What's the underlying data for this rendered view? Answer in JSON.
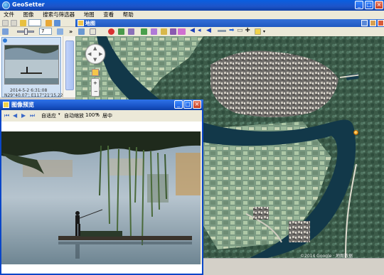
{
  "app": {
    "title": "GeoSetter"
  },
  "menu": {
    "items": [
      "文件",
      "图像",
      "搜索与筛选器",
      "地图",
      "查看",
      "帮助"
    ]
  },
  "left_toolbar": {
    "spinner_value": "7"
  },
  "thumbnail": {
    "timestamp": "2014-5-2 6:31:08",
    "coords": "N29°40.07'; E117°21'15.22\""
  },
  "map_panel": {
    "title": "地图",
    "attribution": "©2014 Google · 地图数据"
  },
  "preview_window": {
    "title": "图像预览",
    "toolbar": {
      "fit_label": "自适应",
      "autoscale_label": "自动缩放",
      "zoom_label": "100%",
      "center_label": "居中"
    }
  },
  "colors": {
    "titlebar": "#1d54c8",
    "menu_bg": "#ece9d8",
    "river": "#123849",
    "marker": "#f08a00",
    "selected_thumb": "#cfe0f3"
  },
  "icons": {
    "app": "globe-icon",
    "map_pin": "map-pin-icon",
    "nav": "pan-control-icon"
  }
}
